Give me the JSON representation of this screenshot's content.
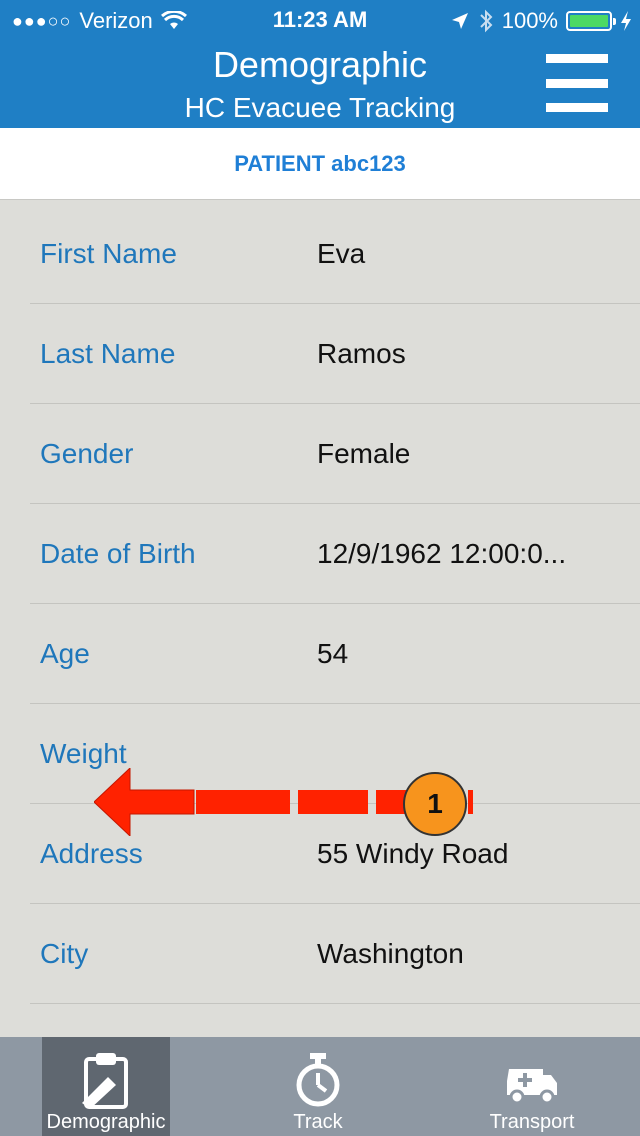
{
  "status_bar": {
    "signal": "●●●○○",
    "carrier": "Verizon",
    "time": "11:23 AM",
    "battery": "100%",
    "battery_level": 1.0
  },
  "header": {
    "title": "Demographic",
    "subtitle": "HC Evacuee Tracking",
    "menu_icon": "hamburger-menu-icon"
  },
  "patient": {
    "label": "PATIENT abc123"
  },
  "fields": [
    {
      "label": "First Name",
      "value": "Eva"
    },
    {
      "label": "Last Name",
      "value": "Ramos"
    },
    {
      "label": "Gender",
      "value": "Female"
    },
    {
      "label": "Date of Birth",
      "value": "12/9/1962 12:00:0..."
    },
    {
      "label": "Age",
      "value": "54"
    },
    {
      "label": "Weight",
      "value": ""
    },
    {
      "label": "Address",
      "value": "55 Windy Road"
    },
    {
      "label": "City",
      "value": "Washington"
    }
  ],
  "annotation": {
    "step": "1",
    "color": "#ff2200"
  },
  "tabs": [
    {
      "label": "Demographic",
      "icon": "clipboard-icon",
      "active": true
    },
    {
      "label": "Track",
      "icon": "stopwatch-icon",
      "active": false
    },
    {
      "label": "Transport",
      "icon": "ambulance-icon",
      "active": false
    }
  ],
  "colors": {
    "header": "#1f7fc5",
    "label": "#1f77bb",
    "patient_text": "#1f7fd6",
    "tab_bar": "#8e98a3",
    "tab_active": "#5f6770"
  }
}
